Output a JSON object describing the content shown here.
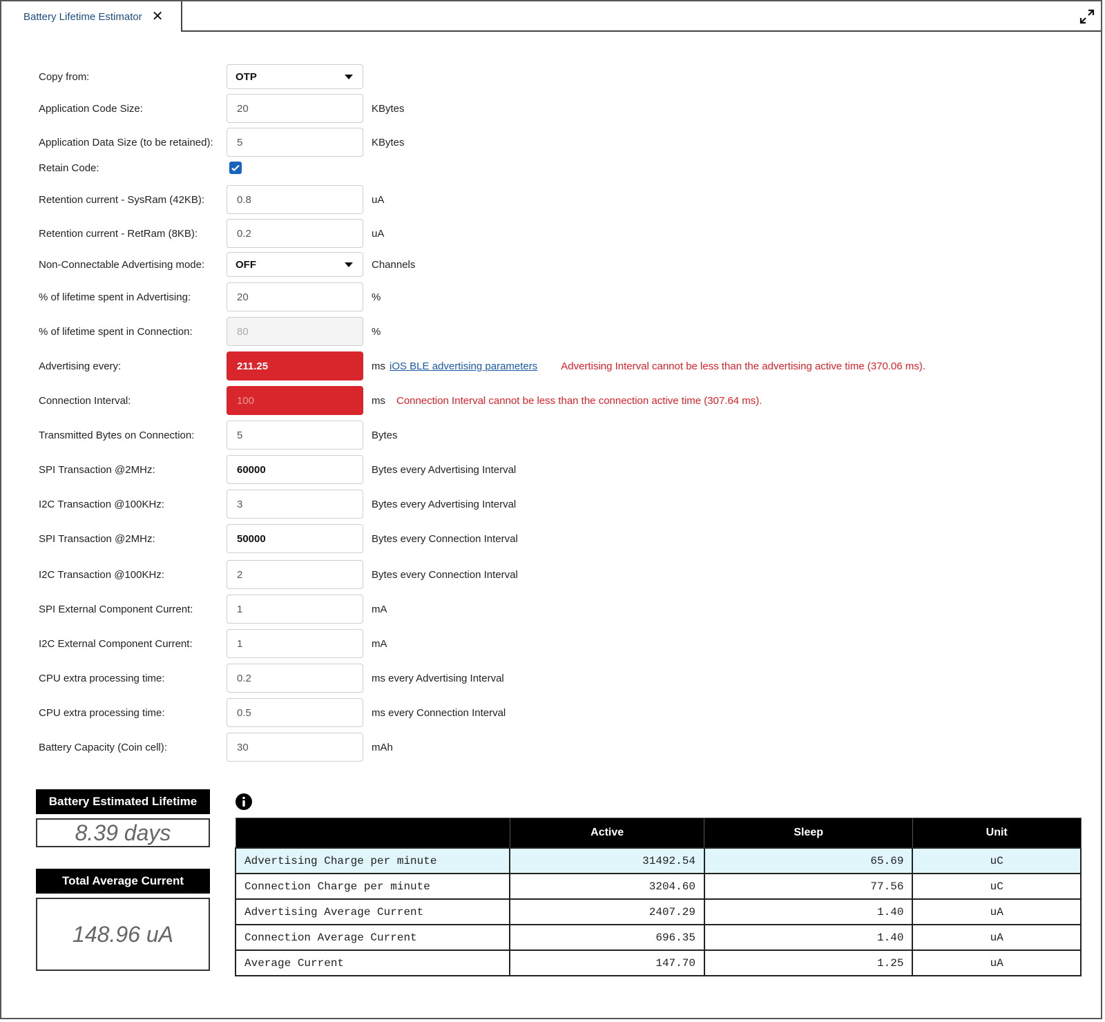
{
  "tab": {
    "title": "Battery Lifetime Estimator"
  },
  "form": {
    "copy_from": {
      "label": "Copy from:",
      "value": "OTP"
    },
    "app_code_size": {
      "label": "Application Code Size:",
      "value": "20",
      "unit": "KBytes"
    },
    "app_data_size": {
      "label": "Application Data Size (to be retained):",
      "value": "5",
      "unit": "KBytes"
    },
    "retain_code": {
      "label": "Retain Code:",
      "checked": true
    },
    "retention_sysram": {
      "label": "Retention current - SysRam (42KB):",
      "value": "0.8",
      "unit": "uA"
    },
    "retention_retram": {
      "label": "Retention current - RetRam (8KB):",
      "value": "0.2",
      "unit": "uA"
    },
    "nonconn_adv_mode": {
      "label": "Non-Connectable Advertising mode:",
      "value": "OFF",
      "unit": "Channels"
    },
    "pct_advertising": {
      "label": "% of lifetime spent in Advertising:",
      "value": "20",
      "unit": "%"
    },
    "pct_connection": {
      "label": "% of lifetime spent in Connection:",
      "value": "80",
      "unit": "%"
    },
    "advertising_every": {
      "label": "Advertising every:",
      "value": "211.25",
      "unit": "ms",
      "link": "iOS BLE advertising parameters",
      "error": "Advertising Interval cannot be less than the advertising active time (370.06 ms)."
    },
    "connection_interval": {
      "label": "Connection Interval:",
      "value": "100",
      "unit": "ms",
      "error": "Connection Interval cannot be less than the connection active time (307.64 ms)."
    },
    "tx_bytes": {
      "label": "Transmitted Bytes on Connection:",
      "value": "5",
      "unit": "Bytes"
    },
    "spi_adv": {
      "label": "SPI Transaction @2MHz:",
      "value": "60000",
      "unit": "Bytes every Advertising Interval"
    },
    "i2c_adv": {
      "label": "I2C Transaction @100KHz:",
      "value": "3",
      "unit": "Bytes every Advertising Interval"
    },
    "spi_conn": {
      "label": "SPI Transaction @2MHz:",
      "value": "50000",
      "unit": "Bytes every Connection Interval"
    },
    "i2c_conn": {
      "label": "I2C Transaction @100KHz:",
      "value": "2",
      "unit": "Bytes every Connection Interval"
    },
    "spi_ext_current": {
      "label": "SPI External Component Current:",
      "value": "1",
      "unit": "mA"
    },
    "i2c_ext_current": {
      "label": "I2C External Component Current:",
      "value": "1",
      "unit": "mA"
    },
    "cpu_adv": {
      "label": "CPU extra processing time:",
      "value": "0.2",
      "unit": "ms every Advertising Interval"
    },
    "cpu_conn": {
      "label": "CPU extra processing time:",
      "value": "0.5",
      "unit": "ms every Connection Interval"
    },
    "battery_capacity": {
      "label": "Battery Capacity (Coin cell):",
      "value": "30",
      "unit": "mAh"
    }
  },
  "summary": {
    "lifetime_title": "Battery Estimated Lifetime",
    "lifetime_value": "8.39 days",
    "current_title": "Total Average Current",
    "current_value": "148.96 uA"
  },
  "table": {
    "headers": [
      "",
      "Active",
      "Sleep",
      "Unit"
    ],
    "rows": [
      {
        "name": "Advertising Charge per minute",
        "active": "31492.54",
        "sleep": "65.69",
        "unit": "uC"
      },
      {
        "name": "Connection Charge per minute",
        "active": "3204.60",
        "sleep": "77.56",
        "unit": "uC"
      },
      {
        "name": "Advertising Average Current",
        "active": "2407.29",
        "sleep": "1.40",
        "unit": "uA"
      },
      {
        "name": "Connection Average Current",
        "active": "696.35",
        "sleep": "1.40",
        "unit": "uA"
      },
      {
        "name": "Average Current",
        "active": "147.70",
        "sleep": "1.25",
        "unit": "uA"
      }
    ]
  },
  "colors": {
    "error": "#d9262c",
    "highlight_row": "#e0f6fa",
    "checkbox": "#1565c0"
  },
  "icons": {
    "tab_close": "close-icon",
    "expand": "expand-icon",
    "info": "info-icon",
    "dropdown": "chevron-down-icon"
  }
}
